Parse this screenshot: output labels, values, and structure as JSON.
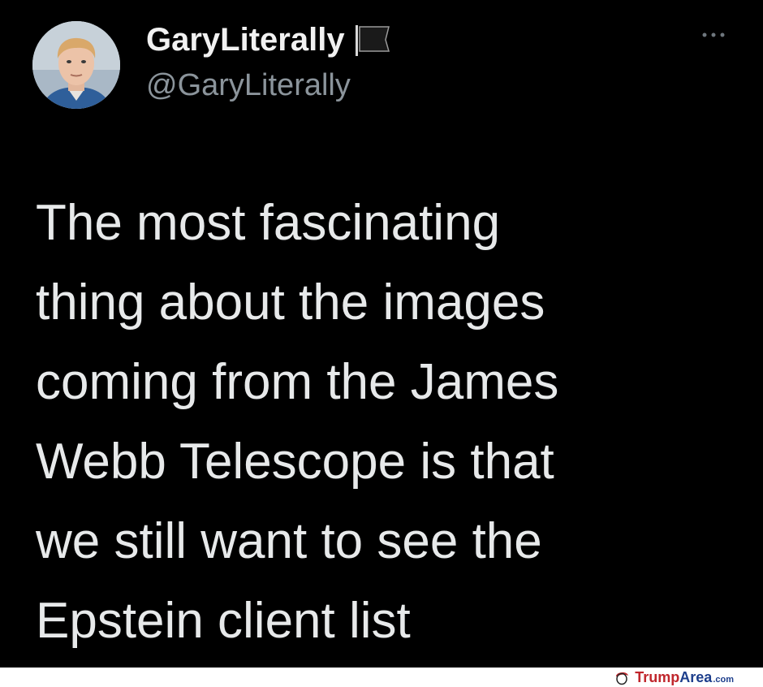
{
  "tweet": {
    "display_name": "GaryLiterally",
    "handle": "@GaryLiterally",
    "text_lines": [
      "The most fascinating",
      "thing about the images",
      "coming from the James",
      "Webb Telescope is that",
      "we still want to see the",
      "Epstein client list"
    ],
    "icons": {
      "avatar": "avatar-photo",
      "flag": "black-flag-icon",
      "more": "more-options-icon"
    }
  },
  "watermark": {
    "brand_first": "Trump",
    "brand_second": "Area",
    "tld": ".com",
    "icon": "trump-hair-icon"
  },
  "colors": {
    "background": "#000000",
    "text": "#e7e9ea",
    "handle": "#8b949b",
    "watermark_red": "#c0262c",
    "watermark_blue": "#1d3e8c"
  }
}
